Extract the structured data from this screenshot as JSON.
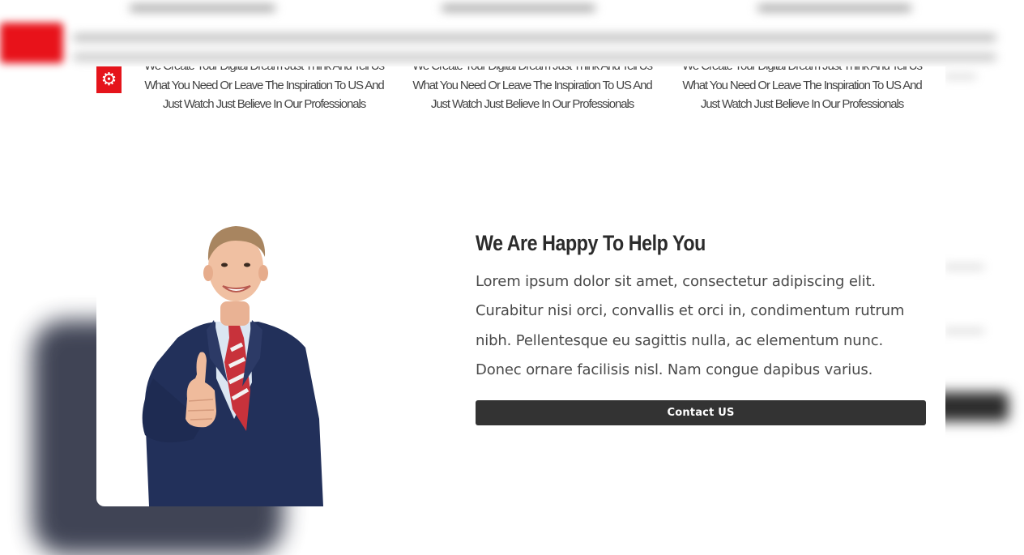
{
  "features": [
    {
      "lines": [
        "We Create Your Digital Dream Just Think And Tell Us",
        "What You Need Or Leave The Inspiration To US And",
        "Just Watch Just Believe In Our Professionals"
      ]
    },
    {
      "lines": [
        "We Create Your Digital Dream Just Think And Tell Us",
        "What You Need Or Leave The Inspiration To US And",
        "Just Watch Just Believe In Our Professionals"
      ]
    },
    {
      "lines": [
        "We Create Your Digital Dream Just Think And Tell Us",
        "What You Need Or Leave The Inspiration To US And",
        "Just Watch Just Believe In Our Professionals"
      ]
    }
  ],
  "feature_icon": "gear-icon",
  "help_section": {
    "heading": "We Are Happy To Help You",
    "paragraph": "Lorem ipsum dolor sit amet, consectetur adipiscing elit. Curabitur nisi orci, convallis et orci in, condimentum rutrum nibh. Pellentesque eu sagittis nulla, ac elementum nunc. Donec ornare facilisis nisl. Nam congue dapibus varius.",
    "button_label": "Contact US"
  },
  "colors": {
    "accent_red": "#e5141b",
    "button_bg": "#333333",
    "heading": "#2b2b2b",
    "body_text": "#4a4a4a"
  }
}
